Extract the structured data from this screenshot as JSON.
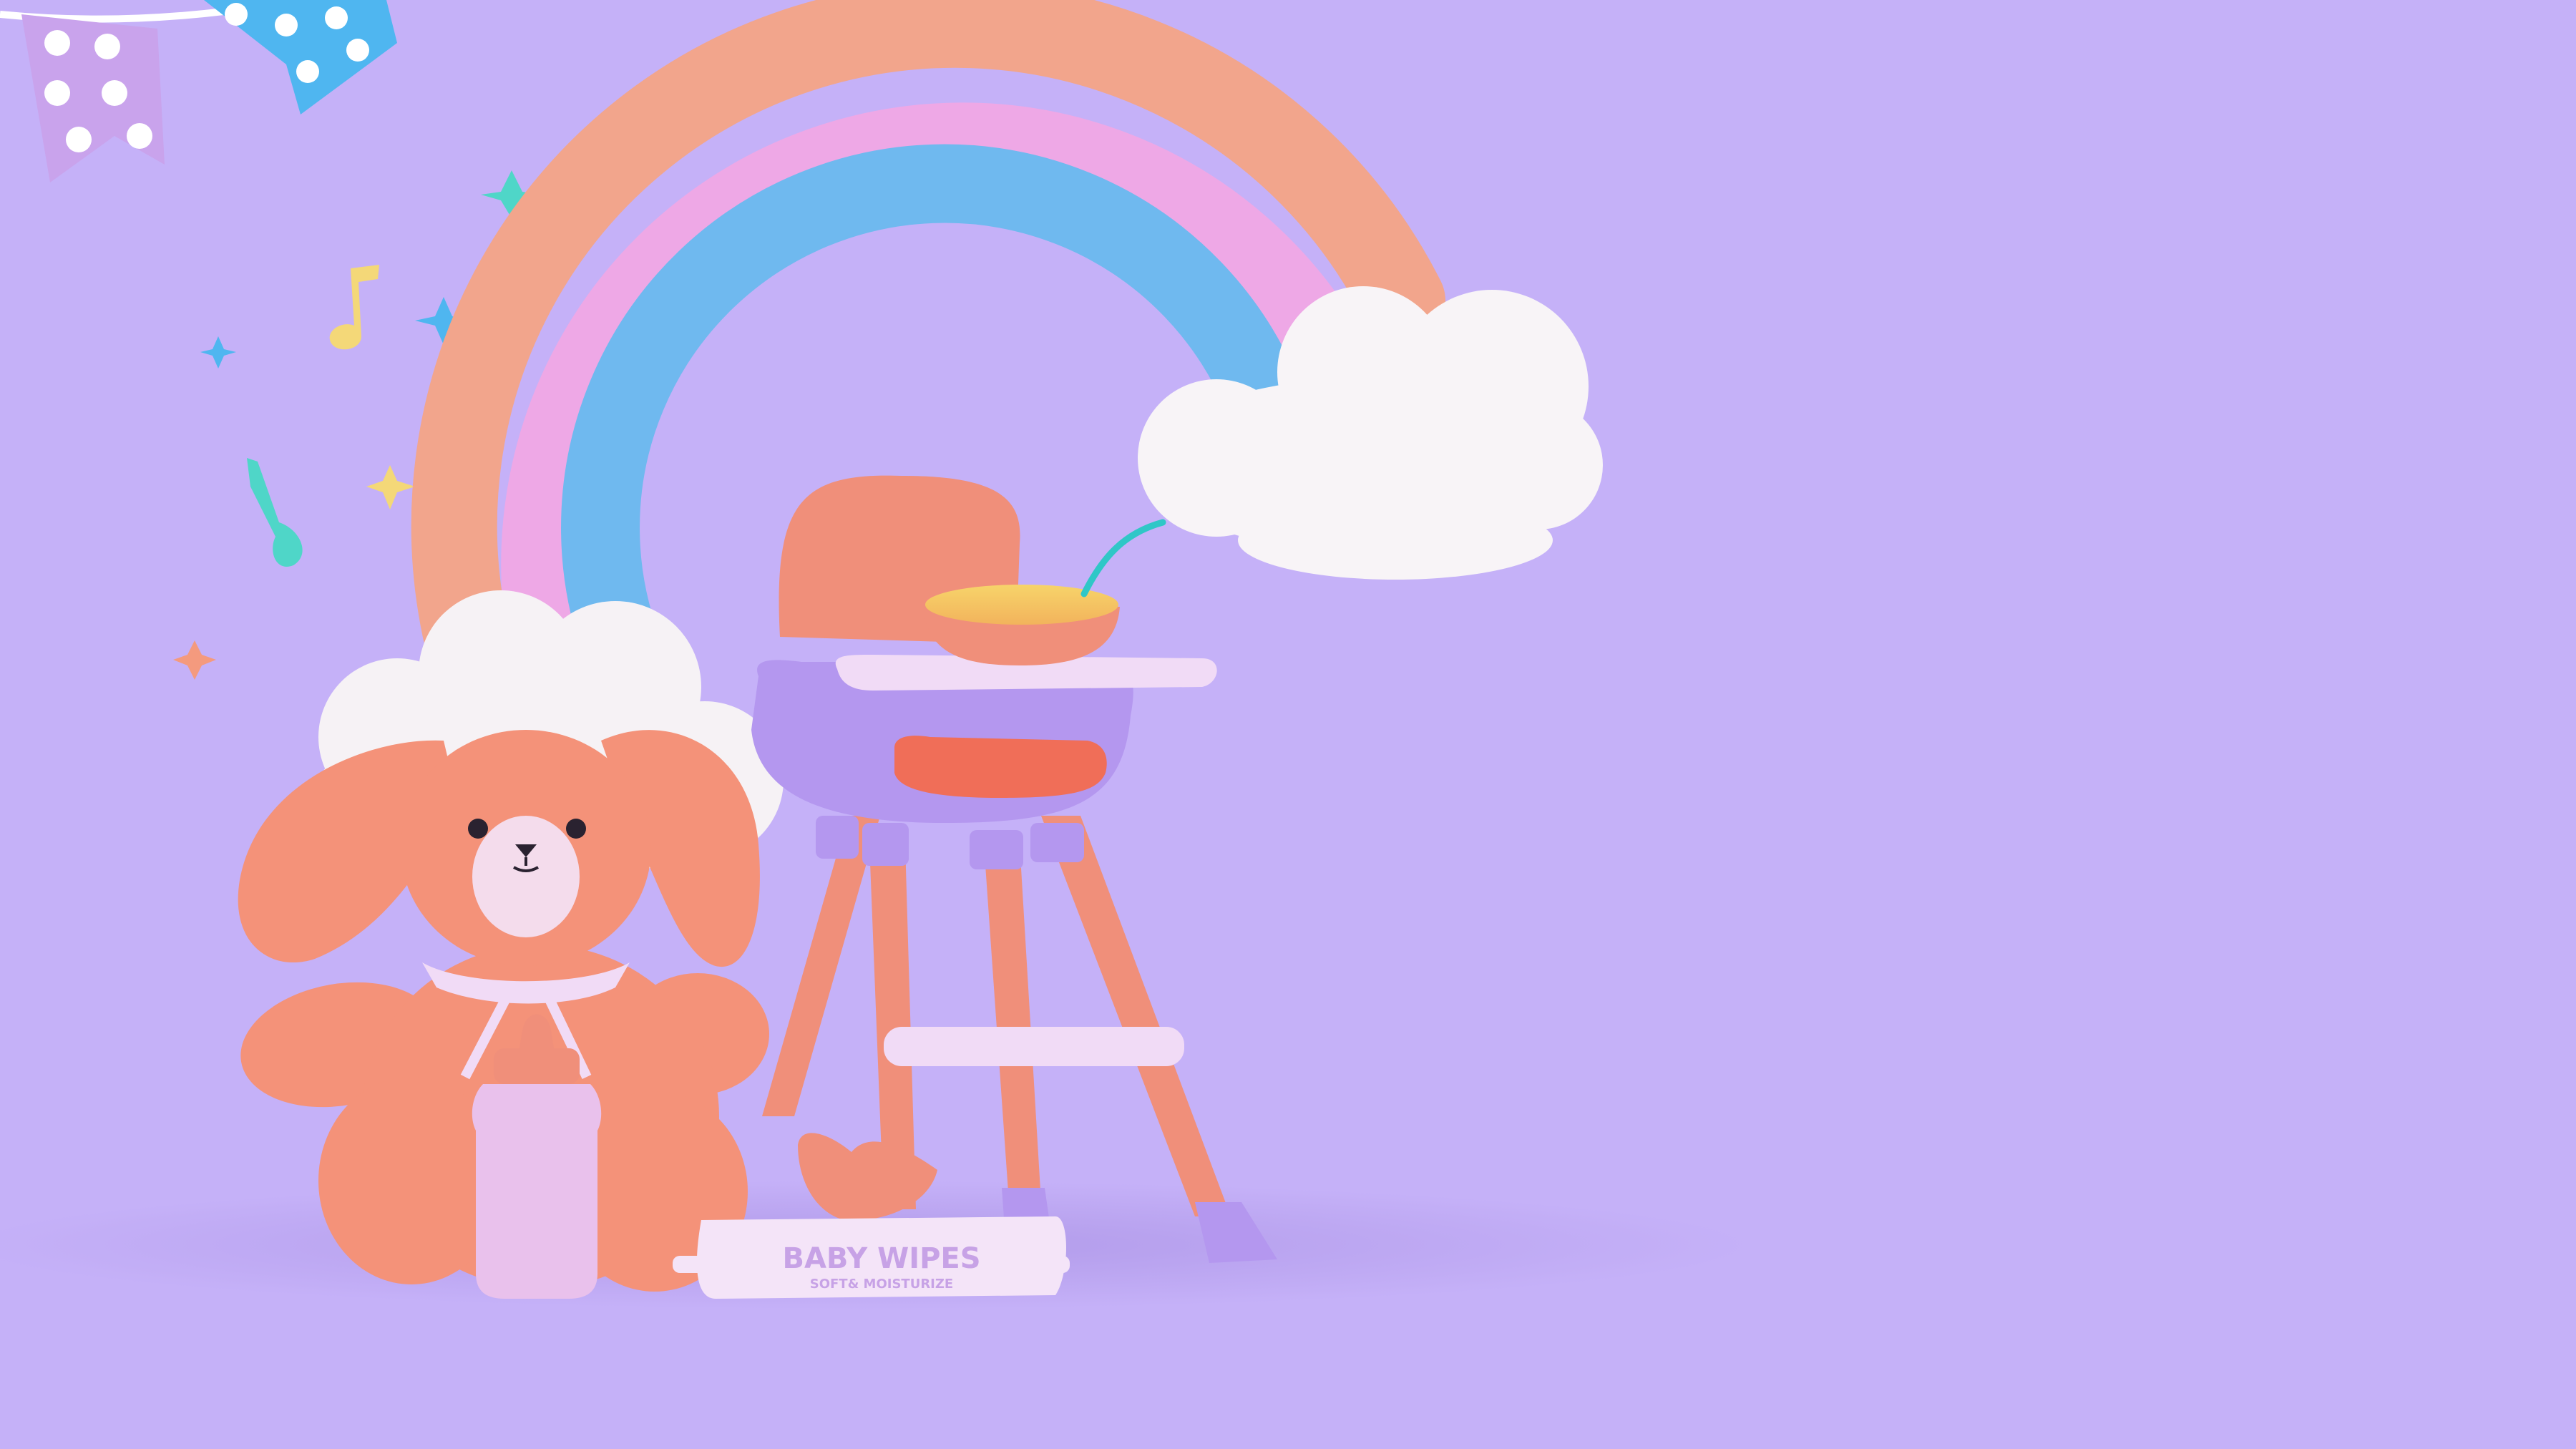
{
  "scene": {
    "description_colors": {
      "background": "#c5b1f8",
      "rainbow_outer": "#f2a58c",
      "rainbow_middle": "#eea8e6",
      "rainbow_inner": "#6fb9ef",
      "bunny": "#f49279",
      "chair_seat": "#b497ef",
      "chair_legs": "#f08f7a",
      "wipes_pack": "#f4e4f8",
      "bottle": "#e9c1ec"
    },
    "wipes_pack": {
      "title": "BABY WIPES",
      "subtitle": "SOFT& MOISTURIZE"
    }
  }
}
